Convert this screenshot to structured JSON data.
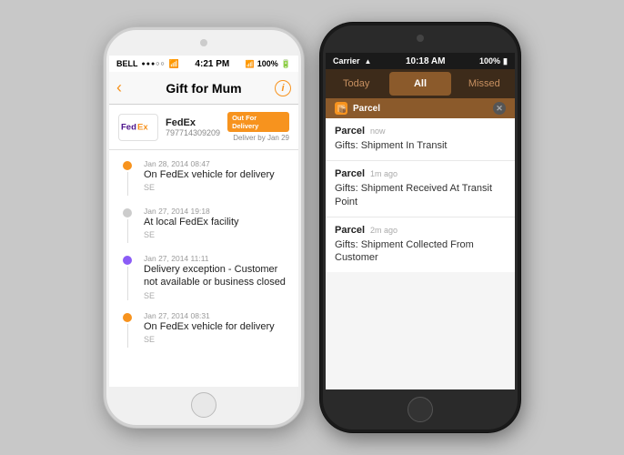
{
  "background": "#c8c8c8",
  "phone_white": {
    "status_bar": {
      "carrier": "BELL",
      "signal": "●●●○○",
      "wifi": "WiFi",
      "time": "4:21 PM",
      "bluetooth": "BT",
      "battery": "100%"
    },
    "nav": {
      "back_icon": "‹",
      "title": "Gift for Mum",
      "info_icon": "i"
    },
    "fedex_card": {
      "name": "FedEx",
      "tracking": "797714309209",
      "badge": "Out For Delivery",
      "deliver": "Deliver by Jan 29"
    },
    "timeline": [
      {
        "dot_color": "orange",
        "date": "Jan 28, 2014 08:47",
        "text": "On FedEx vehicle for delivery",
        "location": "SE"
      },
      {
        "dot_color": "grey",
        "date": "Jan 27, 2014 19:18",
        "text": "At local FedEx facility",
        "location": "SE"
      },
      {
        "dot_color": "purple",
        "date": "Jan 27, 2014 11:11",
        "text": "Delivery exception - Customer not available or business closed",
        "location": "SE"
      },
      {
        "dot_color": "orange",
        "date": "Jan 27, 2014 08:31",
        "text": "On FedEx vehicle for delivery",
        "location": "SE"
      }
    ]
  },
  "phone_dark": {
    "status_bar": {
      "carrier": "Carrier",
      "wifi": "WiFi",
      "time": "10:18 AM",
      "battery": "100%"
    },
    "tabs": [
      {
        "label": "Today",
        "active": false
      },
      {
        "label": "All",
        "active": true
      },
      {
        "label": "Missed",
        "active": false
      }
    ],
    "section_header": "Parcel",
    "close_icon": "✕",
    "notifications": [
      {
        "app": "Parcel",
        "time": "now",
        "body": "Gifts: Shipment In Transit"
      },
      {
        "app": "Parcel",
        "time": "1m ago",
        "body": "Gifts: Shipment Received At Transit Point"
      },
      {
        "app": "Parcel",
        "time": "2m ago",
        "body": "Gifts: Shipment Collected From Customer"
      }
    ]
  }
}
